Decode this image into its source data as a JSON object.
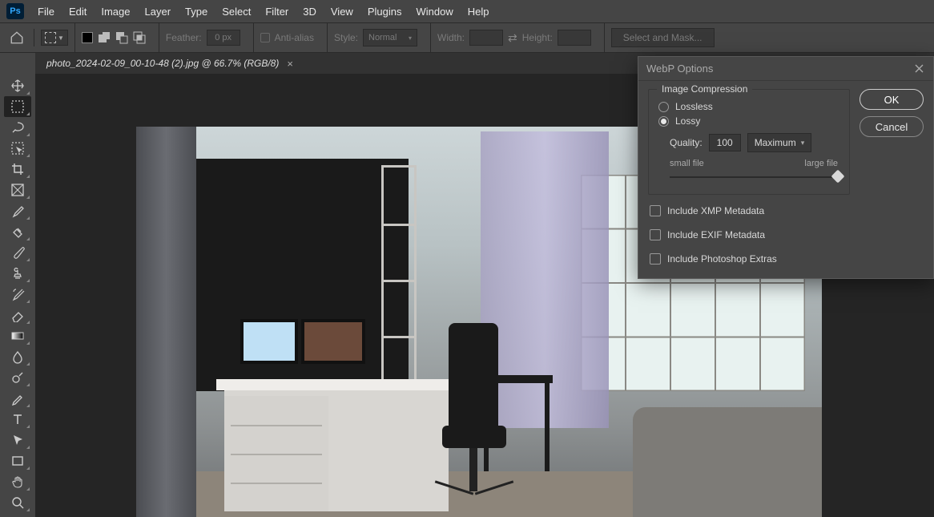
{
  "menu": {
    "items": [
      "File",
      "Edit",
      "Image",
      "Layer",
      "Type",
      "Select",
      "Filter",
      "3D",
      "View",
      "Plugins",
      "Window",
      "Help"
    ]
  },
  "logo": "Ps",
  "options": {
    "feather_label": "Feather:",
    "feather_value": "0 px",
    "antialias_label": "Anti-alias",
    "style_label": "Style:",
    "style_value": "Normal",
    "width_label": "Width:",
    "width_value": "",
    "height_label": "Height:",
    "height_value": "",
    "mask_btn": "Select and Mask..."
  },
  "doc_tab": {
    "title": "photo_2024-02-09_00-10-48 (2).jpg @ 66.7% (RGB/8)",
    "close": "×"
  },
  "tools": [
    {
      "name": "move-tool",
      "icon": "move"
    },
    {
      "name": "marquee-tool",
      "icon": "marquee",
      "active": true
    },
    {
      "name": "lasso-tool",
      "icon": "lasso"
    },
    {
      "name": "object-select-tool",
      "icon": "objsel"
    },
    {
      "name": "crop-tool",
      "icon": "crop"
    },
    {
      "name": "frame-tool",
      "icon": "frame"
    },
    {
      "name": "eyedropper-tool",
      "icon": "eyedrop"
    },
    {
      "name": "healing-brush-tool",
      "icon": "heal"
    },
    {
      "name": "brush-tool",
      "icon": "brush"
    },
    {
      "name": "clone-stamp-tool",
      "icon": "stamp"
    },
    {
      "name": "history-brush-tool",
      "icon": "hbrush"
    },
    {
      "name": "eraser-tool",
      "icon": "eraser"
    },
    {
      "name": "gradient-tool",
      "icon": "gradient"
    },
    {
      "name": "blur-tool",
      "icon": "blur"
    },
    {
      "name": "dodge-tool",
      "icon": "dodge"
    },
    {
      "name": "pen-tool",
      "icon": "pen"
    },
    {
      "name": "type-tool",
      "icon": "type"
    },
    {
      "name": "path-select-tool",
      "icon": "pathsel"
    },
    {
      "name": "rectangle-tool",
      "icon": "rect"
    },
    {
      "name": "hand-tool",
      "icon": "hand"
    },
    {
      "name": "zoom-tool",
      "icon": "zoom"
    }
  ],
  "dialog": {
    "title": "WebP Options",
    "compression_legend": "Image Compression",
    "lossless_label": "Lossless",
    "lossy_label": "Lossy",
    "compression_selected": "lossy",
    "quality_label": "Quality:",
    "quality_value": "100",
    "quality_preset": "Maximum",
    "slider_min_label": "small file",
    "slider_max_label": "large file",
    "slider_pos_pct": 100,
    "include_xmp": "Include XMP Metadata",
    "include_exif": "Include EXIF Metadata",
    "include_ps": "Include Photoshop Extras",
    "xmp_checked": false,
    "exif_checked": false,
    "ps_checked": false,
    "ok_label": "OK",
    "cancel_label": "Cancel"
  }
}
